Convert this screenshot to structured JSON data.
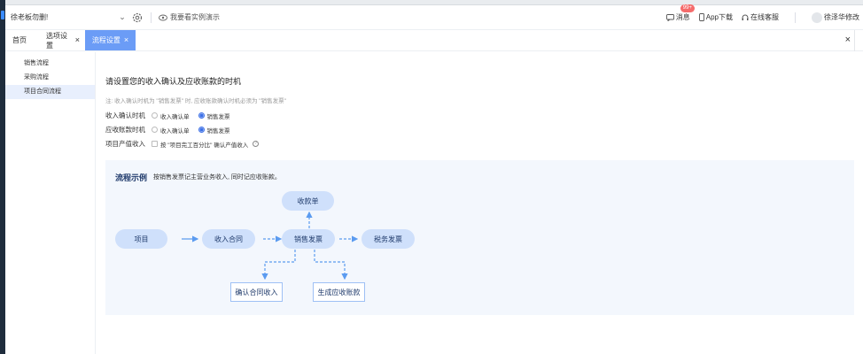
{
  "topbar": {
    "company": "徐老板勿删!",
    "demo_label": "我要看实例演示",
    "tools": [
      {
        "label": "消息",
        "icon": "message-icon",
        "badge": "99+"
      },
      {
        "label": "App下载",
        "icon": "phone-icon"
      },
      {
        "label": "在线客服",
        "icon": "headset-icon"
      },
      {
        "label": "徐泽华修改",
        "icon": "avatar-icon"
      }
    ]
  },
  "tabs": [
    {
      "label": "首页"
    },
    {
      "label": "选项设置",
      "close": "×"
    },
    {
      "label": "流程设置",
      "close": "×",
      "active": true
    }
  ],
  "tabs_close": "×",
  "sidebar": {
    "items": [
      {
        "label": "销售流程"
      },
      {
        "label": "采购流程"
      },
      {
        "label": "项目合同流程",
        "selected": true
      }
    ]
  },
  "main": {
    "heading": "请设置您的收入确认及应收账款的时机",
    "note": "注: 收入确认时机为 \"销售发票\" 时, 应收账款确认时机必须为 \"销售发票\"",
    "rows": [
      {
        "label": "收入确认时机",
        "options": [
          "收入确认单",
          "销售发票"
        ],
        "selected": "销售发票"
      },
      {
        "label": "应收账款时机",
        "options": [
          "收入确认单",
          "销售发票"
        ],
        "selected": "销售发票"
      }
    ],
    "project": {
      "label": "项目产值收入",
      "checkbox_text": "按 \"项目完工百分比\" 确认产值收入",
      "checked": false
    }
  },
  "flow": {
    "title": "流程示例",
    "desc": "按销售发票记主营业务收入, 同时记应收账款。",
    "nodes": {
      "project": "项目",
      "contract": "收入合同",
      "invoice": "销售发票",
      "tax_invoice": "税务发票",
      "receipt": "收款单",
      "confirm": "确认合同收入",
      "receivable": "生成应收账款"
    },
    "colors": {
      "node_fill": "#cfe0fb",
      "arrow": "#5b9bf0",
      "panel": "#f3f7fd"
    }
  }
}
